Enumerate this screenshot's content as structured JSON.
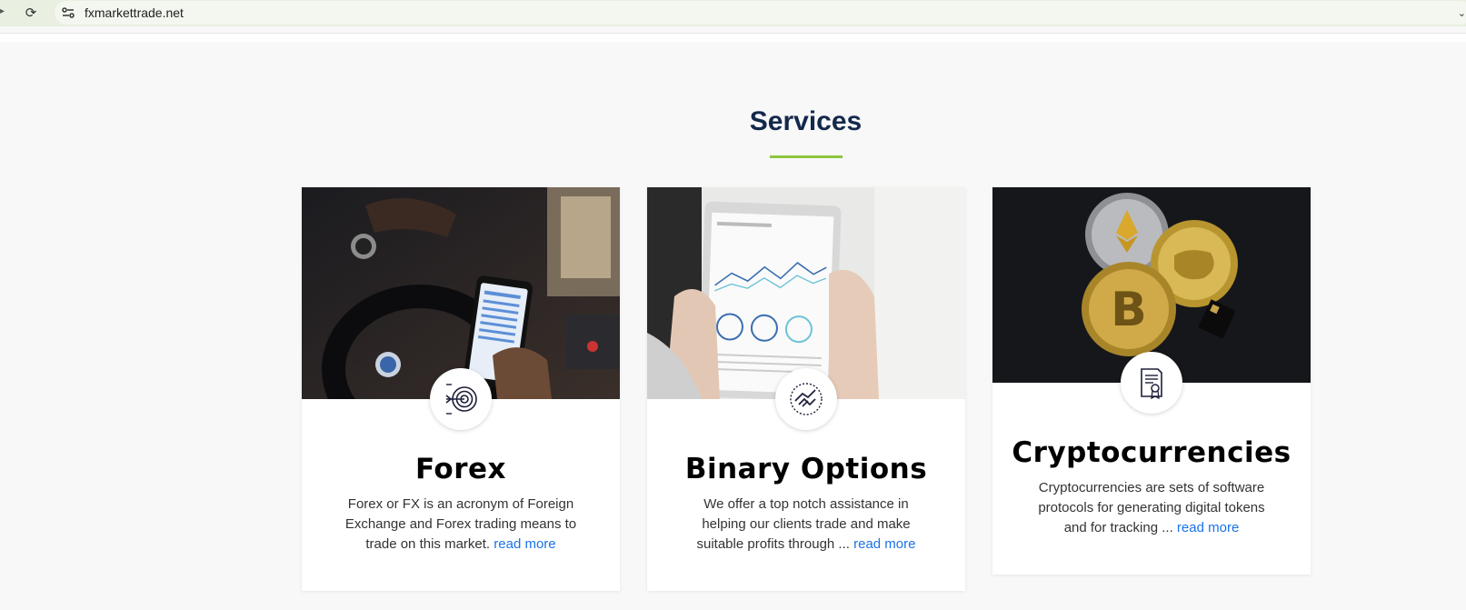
{
  "browser": {
    "url": "fxmarkettrade.net"
  },
  "section": {
    "title": "Services",
    "accent_color": "#8dc63f",
    "title_color": "#13294b"
  },
  "cards": [
    {
      "title": "Forex",
      "text": "Forex or FX is an acronym of Foreign Exchange and Forex trading means to trade on this market. ",
      "link": "read more",
      "icon": "target-icon"
    },
    {
      "title": "Binary Options",
      "text": "We offer a top notch assistance in helping our clients trade and make suitable profits through ... ",
      "link": "read more",
      "icon": "handshake-icon"
    },
    {
      "title": "Cryptocurrencies",
      "text": "Cryptocurrencies are sets of software protocols for generating digital tokens and for tracking ... ",
      "link": "read more",
      "icon": "certificate-icon"
    }
  ],
  "link_color": "#1a73e8"
}
